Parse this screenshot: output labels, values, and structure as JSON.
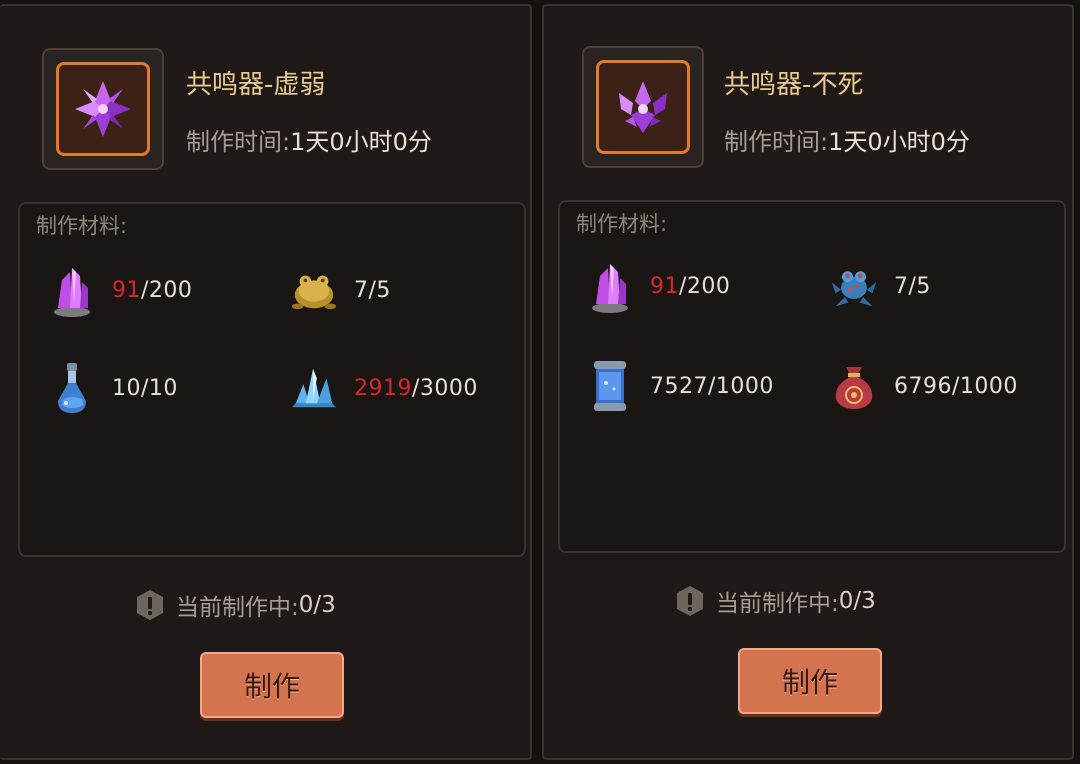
{
  "panels": [
    {
      "title": "共鸣器-虚弱",
      "time_label": "制作时间:",
      "time_value": "1天0小时0分",
      "materials_label": "制作材料:",
      "materials": [
        {
          "icon": "purple-crystal-icon",
          "have": "91",
          "need": "/200",
          "insufficient": true
        },
        {
          "icon": "golden-toad-icon",
          "have": "7",
          "need": "/5",
          "insufficient": false
        },
        {
          "icon": "blue-potion-icon",
          "have": "10",
          "need": "/10",
          "insufficient": false
        },
        {
          "icon": "blue-crystal-cluster-icon",
          "have": "2919",
          "need": "/3000",
          "insufficient": true
        }
      ],
      "status_label": "当前制作中:",
      "status_value": "0/3",
      "button_label": "制作"
    },
    {
      "title": "共鸣器-不死",
      "time_label": "制作时间:",
      "time_value": "1天0小时0分",
      "materials_label": "制作材料:",
      "materials": [
        {
          "icon": "purple-crystal-icon",
          "have": "91",
          "need": "/200",
          "insufficient": true
        },
        {
          "icon": "blue-frog-icon",
          "have": "7",
          "need": "/5",
          "insufficient": false
        },
        {
          "icon": "blue-jar-icon",
          "have": "7527",
          "need": "/1000",
          "insufficient": false
        },
        {
          "icon": "red-pouch-icon",
          "have": "6796",
          "need": "/1000",
          "insufficient": false
        }
      ],
      "status_label": "当前制作中:",
      "status_value": "0/3",
      "button_label": "制作"
    }
  ],
  "colors": {
    "accent_orange": "#e07a2e",
    "title_gold": "#e9c98e",
    "insufficient_red": "#d8282a",
    "button": "#d4744f"
  }
}
